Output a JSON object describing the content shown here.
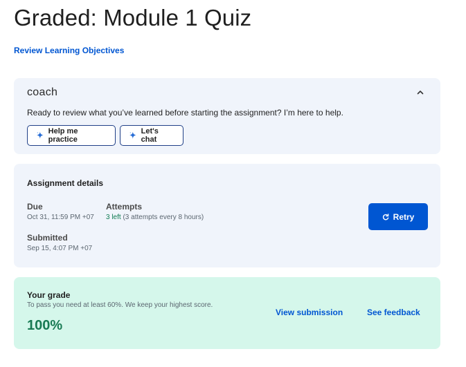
{
  "header": {
    "title": "Graded: Module 1 Quiz",
    "review_link": "Review Learning Objectives"
  },
  "coach": {
    "logo": "coach",
    "message": "Ready to review what you’ve learned before starting the assignment? I’m here to help.",
    "practice_label": "Help me practice",
    "chat_label": "Let's chat",
    "collapse_icon": "chevron-up-icon",
    "button_icon": "sparkle-icon"
  },
  "assignment": {
    "heading": "Assignment details",
    "due_label": "Due",
    "due_value": "Oct 31, 11:59 PM +07",
    "attempts_label": "Attempts",
    "attempts_left": "3 left",
    "attempts_detail": " (3 attempts every 8 hours)",
    "submitted_label": "Submitted",
    "submitted_value": "Sep 15, 4:07 PM +07",
    "retry_label": "Retry",
    "retry_icon": "refresh-icon"
  },
  "grade": {
    "heading": "Your grade",
    "subtext": "To pass you need at least 60%. We keep your highest score.",
    "value": "100%",
    "view_submission": "View submission",
    "see_feedback": "See feedback"
  },
  "colors": {
    "accent": "#0056d2",
    "coach_bg": "#f0f4fb",
    "grade_bg": "#d5f7eb",
    "grade_text": "#187a53"
  }
}
